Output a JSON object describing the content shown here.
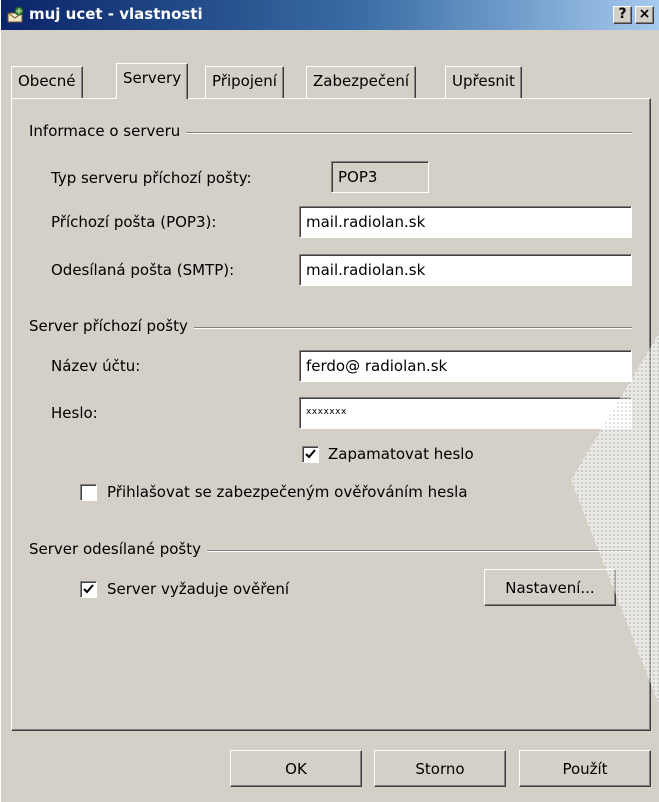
{
  "window": {
    "title": "muj ucet - vlastnosti",
    "help_button": "?",
    "close_button": "×"
  },
  "tabs": [
    {
      "label": "Obecné",
      "active": false
    },
    {
      "label": "Servery",
      "active": true
    },
    {
      "label": "Připojení",
      "active": false
    },
    {
      "label": "Zabezpečení",
      "active": false
    },
    {
      "label": "Upřesnit",
      "active": false
    }
  ],
  "server_info": {
    "group_title": "Informace o serveru",
    "type_label": "Typ serveru příchozí pošty:",
    "type_value": "POP3",
    "incoming_label": "Příchozí pošta (POP3):",
    "incoming_value": "mail.radiolan.sk",
    "outgoing_label": "Odesílaná pošta (SMTP):",
    "outgoing_value": "mail.radiolan.sk"
  },
  "incoming_server": {
    "group_title": "Server příchozí pošty",
    "account_label": "Název účtu:",
    "account_value": "ferdo@ radiolan.sk",
    "password_label": "Heslo:",
    "password_value": "xxxxxxx",
    "remember_label": "Zapamatovat heslo",
    "remember_checked": true,
    "spa_label": "Přihlašovat se zabezpečeným ověřováním hesla",
    "spa_checked": false
  },
  "outgoing_server": {
    "group_title": "Server odesílané pošty",
    "auth_label": "Server vyžaduje ověření",
    "auth_checked": true,
    "settings_button": "Nastavení..."
  },
  "buttons": {
    "ok": "OK",
    "cancel": "Storno",
    "apply": "Použít"
  },
  "colors": {
    "face": "#d4d0c8",
    "title_start": "#0a246a",
    "title_end": "#a6caf0"
  }
}
